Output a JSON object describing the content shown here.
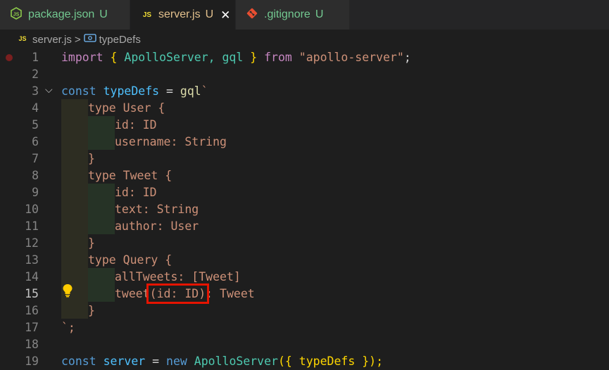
{
  "tabs": [
    {
      "label": "package.json",
      "status": "U",
      "icon": "nodejs-icon",
      "icon_color": "#8cc84b"
    },
    {
      "label": "server.js",
      "status": "U",
      "icon": "javascript-file-icon",
      "icon_color": "#f1dd35"
    },
    {
      "label": ".gitignore",
      "status": "U",
      "icon": "git-icon",
      "icon_color": "#e84e31"
    }
  ],
  "breadcrumb": {
    "file": "server.js",
    "separator": ">",
    "symbol": "typeDefs",
    "file_icon": "javascript-file-icon",
    "symbol_icon": "variable-icon"
  },
  "lines": [
    {
      "n": "1"
    },
    {
      "n": "2"
    },
    {
      "n": "3"
    },
    {
      "n": "4"
    },
    {
      "n": "5"
    },
    {
      "n": "6"
    },
    {
      "n": "7"
    },
    {
      "n": "8"
    },
    {
      "n": "9"
    },
    {
      "n": "10"
    },
    {
      "n": "11"
    },
    {
      "n": "12"
    },
    {
      "n": "13"
    },
    {
      "n": "14"
    },
    {
      "n": "15"
    },
    {
      "n": "16"
    },
    {
      "n": "17"
    },
    {
      "n": "18"
    },
    {
      "n": "19"
    }
  ],
  "code": {
    "l1": {
      "import": "import",
      "ob": "{",
      "a": " ApolloServer, gql ",
      "cb": "}",
      "from": "from",
      "src": "\"apollo-server\"",
      "semi": ";"
    },
    "l3": {
      "const": "const",
      "name": "typeDefs",
      "eq": " = ",
      "fn": "gql",
      "tick": "`"
    },
    "l4": "type User {",
    "l5": "id: ID",
    "l6": "username: String",
    "l7": "}",
    "l8": "type Tweet {",
    "l9": "id: ID",
    "l10": "text: String",
    "l11": "author: User",
    "l12": "}",
    "l13": "type Query {",
    "l14": "allTweets: [Tweet]",
    "l15a": "tweet",
    "l15b": "(id: ID)",
    "l15c": ": Tweet",
    "l16": "}",
    "l17": "`;",
    "l19": {
      "const": "const",
      "name": "server",
      "eq": " = ",
      "new": "new",
      "cls": "ApolloServer",
      "args": "({ typeDefs });"
    }
  },
  "colors": {
    "highlight_box": "#e51400",
    "breakpoint": "#7a1f1f",
    "lightbulb": "#ffcc00"
  }
}
